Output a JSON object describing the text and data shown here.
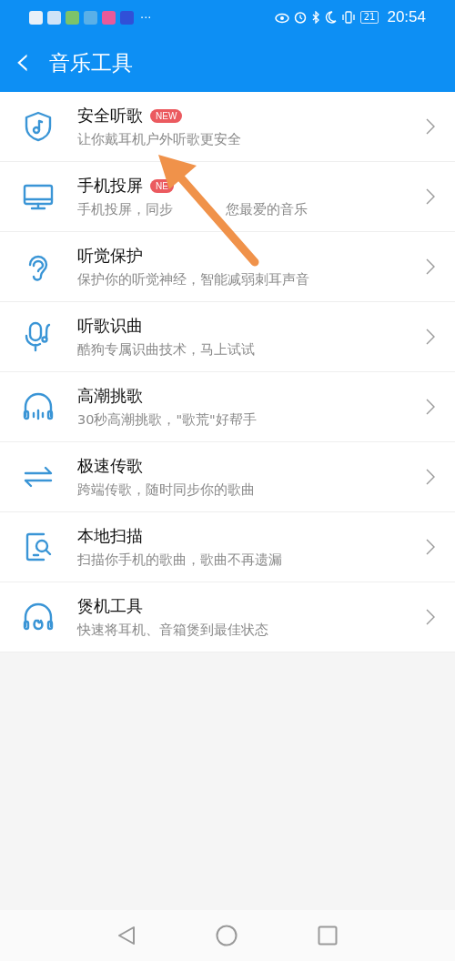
{
  "status_bar": {
    "more": "···",
    "battery": "21",
    "time": "20:54"
  },
  "header": {
    "back": "‹",
    "title": "音乐工具"
  },
  "items": [
    {
      "title": "安全听歌",
      "subtitle": "让你戴耳机户外听歌更安全",
      "badge": "NEW"
    },
    {
      "title": "手机投屏",
      "subtitle": "手机投屏，同步",
      "subtitle_after": "您最爱的音乐",
      "badge": "NE"
    },
    {
      "title": "听觉保护",
      "subtitle": "保护你的听觉神经，智能减弱刺耳声音"
    },
    {
      "title": "听歌识曲",
      "subtitle": "酷狗专属识曲技术，马上试试"
    },
    {
      "title": "高潮挑歌",
      "subtitle": "30秒高潮挑歌，\"歌荒\"好帮手"
    },
    {
      "title": "极速传歌",
      "subtitle": "跨端传歌，随时同步你的歌曲"
    },
    {
      "title": "本地扫描",
      "subtitle": "扫描你手机的歌曲，歌曲不再遗漏"
    },
    {
      "title": "煲机工具",
      "subtitle": "快速将耳机、音箱煲到最佳状态"
    }
  ]
}
